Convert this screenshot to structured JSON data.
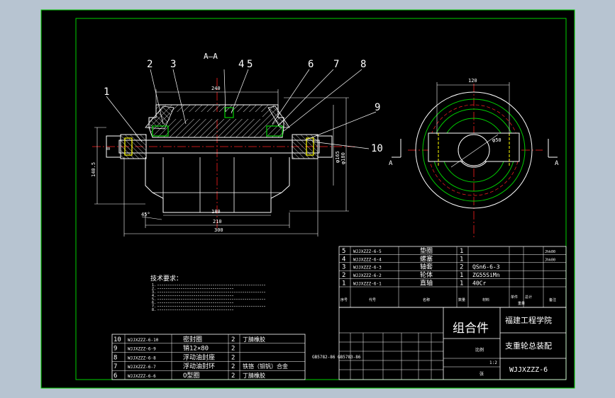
{
  "colors": {
    "background": "#b7c4d1",
    "paper": "#000000",
    "frame": "#00d000",
    "geometry": "#ffffff",
    "centerline": "#ff2020",
    "hatch": "#ffffff",
    "dimension": "#ffffff",
    "hidden": "#ffff00",
    "cyan_line": "#00ffff"
  },
  "section": {
    "label": "A—A",
    "callouts": [
      "1",
      "2",
      "3",
      "4",
      "5",
      "6",
      "7",
      "8",
      "9",
      "10"
    ]
  },
  "dims": {
    "d240": "240",
    "d180": "180",
    "d210": "210",
    "d300": "300",
    "d140_5": "140.5",
    "d8": "8",
    "d165": "φ165",
    "d180v": "φ180",
    "d45": "45°",
    "side_120": "120",
    "side_phi": "φ50"
  },
  "side_view": {
    "section_mark_left": "A",
    "section_mark_right": "A"
  },
  "notes": {
    "title": "技术要求：",
    "lines": [
      "1.",
      "2.",
      "3.",
      "4.",
      "5.",
      "6.",
      "7.",
      "8."
    ]
  },
  "bom_upper": [
    {
      "no": "5",
      "code": "WJJXZZZ-6-5",
      "name": "垫圈",
      "qty": "1",
      "material": "",
      "note": "Jhk00"
    },
    {
      "no": "4",
      "code": "WJJXZZZ-6-4",
      "name": "螺塞",
      "qty": "1",
      "material": "",
      "note": "Jhk00"
    },
    {
      "no": "3",
      "code": "WJJXZZZ-6-3",
      "name": "轴套",
      "qty": "2",
      "material": "QSn6-6-3",
      "note": ""
    },
    {
      "no": "2",
      "code": "WJJXZZZ-6-2",
      "name": "轮体",
      "qty": "1",
      "material": "ZG55SiMn",
      "note": ""
    },
    {
      "no": "1",
      "code": "WJJXZZZ-6-1",
      "name": "直轴",
      "qty": "1",
      "material": "40Cr",
      "note": ""
    }
  ],
  "bom_upper_header": {
    "no": "序号",
    "code": "代号",
    "name": "名称",
    "qty": "数量",
    "material": "材料",
    "unit_weight": "单件",
    "total_weight": "总计",
    "weight": "重量",
    "note": "备注"
  },
  "bom_lower": [
    {
      "no": "10",
      "code": "WJJXZZZ-6-10",
      "name": "密封圈",
      "qty": "2",
      "material": "丁腈橡胶"
    },
    {
      "no": "9",
      "code": "WJJXZZZ-6-9",
      "name": "销12×80",
      "qty": "2",
      "material": ""
    },
    {
      "no": "8",
      "code": "WJJXZZZ-6-8",
      "name": "浮动油封座",
      "qty": "2",
      "material": ""
    },
    {
      "no": "7",
      "code": "WJJXZZZ-6-7",
      "name": "浮动油封环",
      "qty": "2",
      "material": "铁铬（钼钒）合金"
    },
    {
      "no": "6",
      "code": "WJJXZZZ-6-6",
      "name": "O型圈",
      "qty": "2",
      "material": "丁腈橡胶"
    }
  ],
  "title_block": {
    "drawing_type": "组合件",
    "school": "福建工程学院",
    "drawing_name": "支重轮总装配",
    "drawing_no": "WJJXZZZ-6",
    "std1": "GB5782-86",
    "std2": "GB5783-86",
    "ratio_label": "比例",
    "sheet_label": "张",
    "scale": "1:2"
  }
}
